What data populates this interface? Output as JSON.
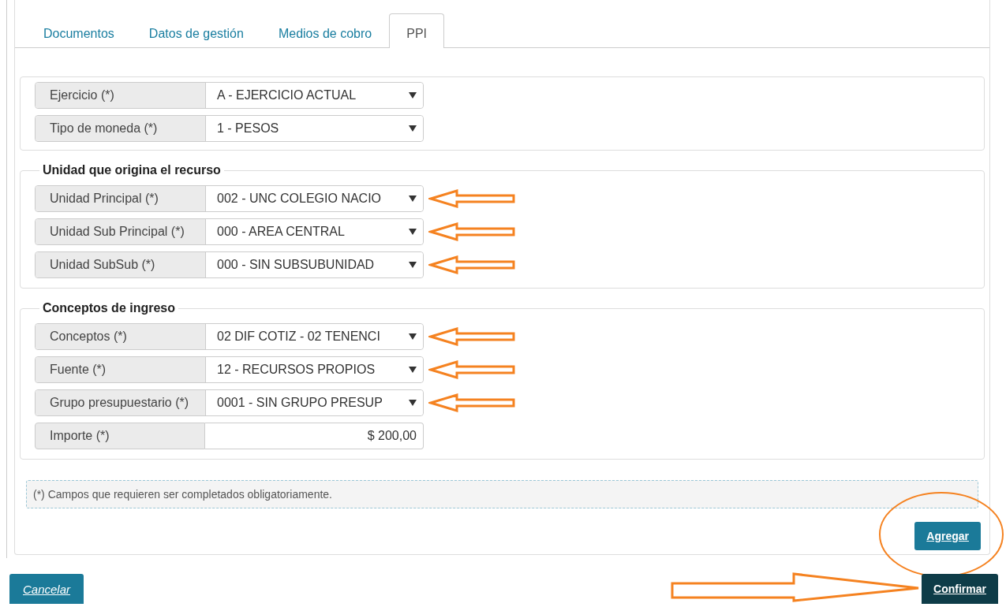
{
  "tabs": [
    {
      "label": "Documentos",
      "selected": false
    },
    {
      "label": "Datos de gestión",
      "selected": false
    },
    {
      "label": "Medios de cobro",
      "selected": false
    },
    {
      "label": "PPI",
      "selected": true
    }
  ],
  "sections": [
    {
      "fields": [
        {
          "label": "Ejercicio (*)",
          "value": "A - EJERCICIO ACTUAL",
          "kind": "select",
          "annotated": false
        },
        {
          "label": "Tipo de moneda (*)",
          "value": "1 - PESOS",
          "kind": "select",
          "annotated": false
        }
      ]
    },
    {
      "legend": "Unidad que origina el recurso",
      "fields": [
        {
          "label": "Unidad Principal (*)",
          "value": "002 - UNC COLEGIO NACIO",
          "kind": "select",
          "annotated": true
        },
        {
          "label": "Unidad Sub Principal (*)",
          "value": "000 - AREA CENTRAL",
          "kind": "select",
          "annotated": true
        },
        {
          "label": "Unidad SubSub (*)",
          "value": "000 - SIN SUBSUBUNIDAD",
          "kind": "select",
          "annotated": true
        }
      ]
    },
    {
      "legend": "Conceptos de ingreso",
      "fields": [
        {
          "label": "Conceptos (*)",
          "value": "02 DIF COTIZ - 02 TENENCI",
          "kind": "select",
          "annotated": true
        },
        {
          "label": "Fuente (*)",
          "value": "12 - RECURSOS PROPIOS",
          "kind": "select",
          "annotated": true
        },
        {
          "label": "Grupo presupuestario (*)",
          "value": "0001 - SIN GRUPO PRESUP",
          "kind": "select",
          "annotated": true
        },
        {
          "label": "Importe (*)",
          "value": "$ 200,00",
          "kind": "input",
          "annotated": false
        }
      ]
    }
  ],
  "note": "(*) Campos que requieren ser completados obligatoriamente.",
  "add_button": {
    "label": "Agregar",
    "annotated": true
  },
  "cancel_button": {
    "label": "Cancelar"
  },
  "confirm_button": {
    "label": "Confirmar",
    "annotated": true
  }
}
